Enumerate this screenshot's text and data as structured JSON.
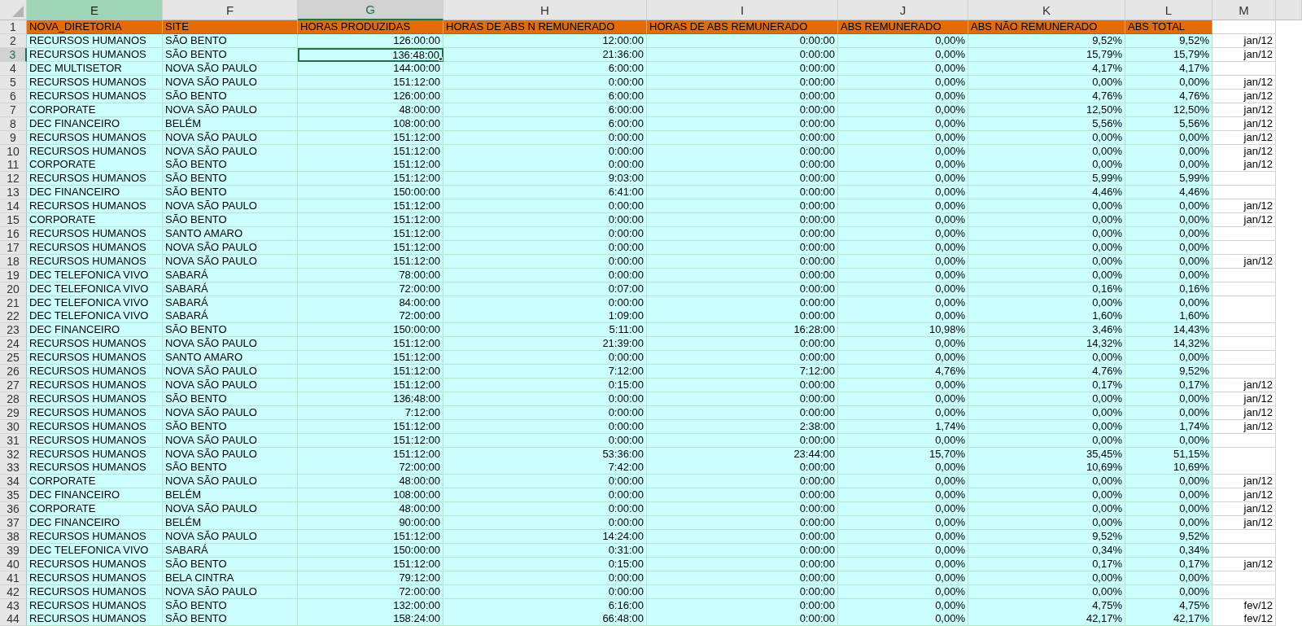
{
  "columns": [
    {
      "letter": "E",
      "kind": "text",
      "selected": false,
      "highlighted": true
    },
    {
      "letter": "F",
      "kind": "text",
      "selected": false,
      "highlighted": false
    },
    {
      "letter": "G",
      "kind": "number",
      "selected": true,
      "highlighted": false
    },
    {
      "letter": "H",
      "kind": "number",
      "selected": false,
      "highlighted": false
    },
    {
      "letter": "I",
      "kind": "number",
      "selected": false,
      "highlighted": false
    },
    {
      "letter": "J",
      "kind": "number",
      "selected": false,
      "highlighted": false
    },
    {
      "letter": "K",
      "kind": "number",
      "selected": false,
      "highlighted": false
    },
    {
      "letter": "L",
      "kind": "number",
      "selected": false,
      "highlighted": false
    },
    {
      "letter": "M",
      "kind": "number",
      "selected": false,
      "highlighted": false
    }
  ],
  "header_row": {
    "n": "1",
    "labels": [
      "NOVA_DIRETORIA",
      "SITE",
      "HORAS PRODUZIDAS",
      "HORAS DE ABS N REMUNERADO",
      "HORAS DE ABS REMUNERADO",
      "ABS REMUNERADO",
      "ABS NÃO REMUNERADO",
      "ABS TOTAL"
    ]
  },
  "rows": [
    {
      "n": "2",
      "selected": false,
      "cells": [
        "RECURSOS HUMANOS",
        "SÃO BENTO",
        "126:00:00",
        "12:00:00",
        "0:00:00",
        "0,00%",
        "9,52%",
        "9,52%",
        "jan/12"
      ]
    },
    {
      "n": "3",
      "selected": true,
      "cells": [
        "RECURSOS HUMANOS",
        "SÃO BENTO",
        "136:48:00",
        "21:36:00",
        "0:00:00",
        "0,00%",
        "15,79%",
        "15,79%",
        "jan/12"
      ]
    },
    {
      "n": "4",
      "selected": false,
      "cells": [
        "DEC MULTISETOR",
        "NOVA SÃO PAULO",
        "144:00:00",
        "6:00:00",
        "0:00:00",
        "0,00%",
        "4,17%",
        "4,17%"
      ]
    },
    {
      "n": "5",
      "selected": false,
      "cells": [
        "RECURSOS HUMANOS",
        "NOVA SÃO PAULO",
        "151:12:00",
        "0:00:00",
        "0:00:00",
        "0,00%",
        "0,00%",
        "0,00%",
        "jan/12"
      ]
    },
    {
      "n": "6",
      "selected": false,
      "cells": [
        "RECURSOS HUMANOS",
        "SÃO BENTO",
        "126:00:00",
        "6:00:00",
        "0:00:00",
        "0,00%",
        "4,76%",
        "4,76%",
        "jan/12"
      ]
    },
    {
      "n": "7",
      "selected": false,
      "cells": [
        "CORPORATE",
        "NOVA SÃO PAULO",
        "48:00:00",
        "6:00:00",
        "0:00:00",
        "0,00%",
        "12,50%",
        "12,50%",
        "jan/12"
      ]
    },
    {
      "n": "8",
      "selected": false,
      "cells": [
        "DEC FINANCEIRO",
        "BELÉM",
        "108:00:00",
        "6:00:00",
        "0:00:00",
        "0,00%",
        "5,56%",
        "5,56%",
        "jan/12"
      ]
    },
    {
      "n": "9",
      "selected": false,
      "cells": [
        "RECURSOS HUMANOS",
        "NOVA SÃO PAULO",
        "151:12:00",
        "0:00:00",
        "0:00:00",
        "0,00%",
        "0,00%",
        "0,00%",
        "jan/12"
      ]
    },
    {
      "n": "10",
      "selected": false,
      "cells": [
        "RECURSOS HUMANOS",
        "NOVA SÃO PAULO",
        "151:12:00",
        "0:00:00",
        "0:00:00",
        "0,00%",
        "0,00%",
        "0,00%",
        "jan/12"
      ]
    },
    {
      "n": "11",
      "selected": false,
      "cells": [
        "CORPORATE",
        "SÃO BENTO",
        "151:12:00",
        "0:00:00",
        "0:00:00",
        "0,00%",
        "0,00%",
        "0,00%",
        "jan/12"
      ]
    },
    {
      "n": "12",
      "selected": false,
      "cells": [
        "RECURSOS HUMANOS",
        "SÃO BENTO",
        "151:12:00",
        "9:03:00",
        "0:00:00",
        "0,00%",
        "5,99%",
        "5,99%"
      ]
    },
    {
      "n": "13",
      "selected": false,
      "cells": [
        "DEC FINANCEIRO",
        "SÃO BENTO",
        "150:00:00",
        "6:41:00",
        "0:00:00",
        "0,00%",
        "4,46%",
        "4,46%"
      ]
    },
    {
      "n": "14",
      "selected": false,
      "cells": [
        "RECURSOS HUMANOS",
        "NOVA SÃO PAULO",
        "151:12:00",
        "0:00:00",
        "0:00:00",
        "0,00%",
        "0,00%",
        "0,00%",
        "jan/12"
      ]
    },
    {
      "n": "15",
      "selected": false,
      "cells": [
        "CORPORATE",
        "SÃO BENTO",
        "151:12:00",
        "0:00:00",
        "0:00:00",
        "0,00%",
        "0,00%",
        "0,00%",
        "jan/12"
      ]
    },
    {
      "n": "16",
      "selected": false,
      "cells": [
        "RECURSOS HUMANOS",
        "SANTO AMARO",
        "151:12:00",
        "0:00:00",
        "0:00:00",
        "0,00%",
        "0,00%",
        "0,00%"
      ]
    },
    {
      "n": "17",
      "selected": false,
      "cells": [
        "RECURSOS HUMANOS",
        "NOVA SÃO PAULO",
        "151:12:00",
        "0:00:00",
        "0:00:00",
        "0,00%",
        "0,00%",
        "0,00%"
      ]
    },
    {
      "n": "18",
      "selected": false,
      "cells": [
        "RECURSOS HUMANOS",
        "NOVA SÃO PAULO",
        "151:12:00",
        "0:00:00",
        "0:00:00",
        "0,00%",
        "0,00%",
        "0,00%",
        "jan/12"
      ]
    },
    {
      "n": "19",
      "selected": false,
      "cells": [
        "DEC TELEFONICA VIVO",
        "SABARÁ",
        "78:00:00",
        "0:00:00",
        "0:00:00",
        "0,00%",
        "0,00%",
        "0,00%"
      ]
    },
    {
      "n": "20",
      "selected": false,
      "cells": [
        "DEC TELEFONICA VIVO",
        "SABARÁ",
        "72:00:00",
        "0:07:00",
        "0:00:00",
        "0,00%",
        "0,16%",
        "0,16%"
      ]
    },
    {
      "n": "21",
      "selected": false,
      "cells": [
        "DEC TELEFONICA VIVO",
        "SABARÁ",
        "84:00:00",
        "0:00:00",
        "0:00:00",
        "0,00%",
        "0,00%",
        "0,00%"
      ]
    },
    {
      "n": "22",
      "selected": false,
      "cells": [
        "DEC TELEFONICA VIVO",
        "SABARÁ",
        "72:00:00",
        "1:09:00",
        "0:00:00",
        "0,00%",
        "1,60%",
        "1,60%"
      ]
    },
    {
      "n": "23",
      "selected": false,
      "cells": [
        "DEC FINANCEIRO",
        "SÃO BENTO",
        "150:00:00",
        "5:11:00",
        "16:28:00",
        "10,98%",
        "3,46%",
        "14,43%"
      ]
    },
    {
      "n": "24",
      "selected": false,
      "cells": [
        "RECURSOS HUMANOS",
        "NOVA SÃO PAULO",
        "151:12:00",
        "21:39:00",
        "0:00:00",
        "0,00%",
        "14,32%",
        "14,32%"
      ]
    },
    {
      "n": "25",
      "selected": false,
      "cells": [
        "RECURSOS HUMANOS",
        "SANTO AMARO",
        "151:12:00",
        "0:00:00",
        "0:00:00",
        "0,00%",
        "0,00%",
        "0,00%"
      ]
    },
    {
      "n": "26",
      "selected": false,
      "cells": [
        "RECURSOS HUMANOS",
        "NOVA SÃO PAULO",
        "151:12:00",
        "7:12:00",
        "7:12:00",
        "4,76%",
        "4,76%",
        "9,52%"
      ]
    },
    {
      "n": "27",
      "selected": false,
      "cells": [
        "RECURSOS HUMANOS",
        "NOVA SÃO PAULO",
        "151:12:00",
        "0:15:00",
        "0:00:00",
        "0,00%",
        "0,17%",
        "0,17%",
        "jan/12"
      ]
    },
    {
      "n": "28",
      "selected": false,
      "cells": [
        "RECURSOS HUMANOS",
        "SÃO BENTO",
        "136:48:00",
        "0:00:00",
        "0:00:00",
        "0,00%",
        "0,00%",
        "0,00%",
        "jan/12"
      ]
    },
    {
      "n": "29",
      "selected": false,
      "cells": [
        "RECURSOS HUMANOS",
        "NOVA SÃO PAULO",
        "7:12:00",
        "0:00:00",
        "0:00:00",
        "0,00%",
        "0,00%",
        "0,00%",
        "jan/12"
      ]
    },
    {
      "n": "30",
      "selected": false,
      "cells": [
        "RECURSOS HUMANOS",
        "SÃO BENTO",
        "151:12:00",
        "0:00:00",
        "2:38:00",
        "1,74%",
        "0,00%",
        "1,74%",
        "jan/12"
      ]
    },
    {
      "n": "31",
      "selected": false,
      "cells": [
        "RECURSOS HUMANOS",
        "NOVA SÃO PAULO",
        "151:12:00",
        "0:00:00",
        "0:00:00",
        "0,00%",
        "0,00%",
        "0,00%"
      ]
    },
    {
      "n": "32",
      "selected": false,
      "cells": [
        "RECURSOS HUMANOS",
        "NOVA SÃO PAULO",
        "151:12:00",
        "53:36:00",
        "23:44:00",
        "15,70%",
        "35,45%",
        "51,15%"
      ]
    },
    {
      "n": "33",
      "selected": false,
      "cells": [
        "RECURSOS HUMANOS",
        "SÃO BENTO",
        "72:00:00",
        "7:42:00",
        "0:00:00",
        "0,00%",
        "10,69%",
        "10,69%"
      ]
    },
    {
      "n": "34",
      "selected": false,
      "cells": [
        "CORPORATE",
        "NOVA SÃO PAULO",
        "48:00:00",
        "0:00:00",
        "0:00:00",
        "0,00%",
        "0,00%",
        "0,00%",
        "jan/12"
      ]
    },
    {
      "n": "35",
      "selected": false,
      "cells": [
        "DEC FINANCEIRO",
        "BELÉM",
        "108:00:00",
        "0:00:00",
        "0:00:00",
        "0,00%",
        "0,00%",
        "0,00%",
        "jan/12"
      ]
    },
    {
      "n": "36",
      "selected": false,
      "cells": [
        "CORPORATE",
        "NOVA SÃO PAULO",
        "48:00:00",
        "0:00:00",
        "0:00:00",
        "0,00%",
        "0,00%",
        "0,00%",
        "jan/12"
      ]
    },
    {
      "n": "37",
      "selected": false,
      "cells": [
        "DEC FINANCEIRO",
        "BELÉM",
        "90:00:00",
        "0:00:00",
        "0:00:00",
        "0,00%",
        "0,00%",
        "0,00%",
        "jan/12"
      ]
    },
    {
      "n": "38",
      "selected": false,
      "cells": [
        "RECURSOS HUMANOS",
        "NOVA SÃO PAULO",
        "151:12:00",
        "14:24:00",
        "0:00:00",
        "0,00%",
        "9,52%",
        "9,52%"
      ]
    },
    {
      "n": "39",
      "selected": false,
      "cells": [
        "DEC TELEFONICA VIVO",
        "SABARÁ",
        "150:00:00",
        "0:31:00",
        "0:00:00",
        "0,00%",
        "0,34%",
        "0,34%"
      ]
    },
    {
      "n": "40",
      "selected": false,
      "cells": [
        "RECURSOS HUMANOS",
        "SÃO BENTO",
        "151:12:00",
        "0:15:00",
        "0:00:00",
        "0,00%",
        "0,17%",
        "0,17%",
        "jan/12"
      ]
    },
    {
      "n": "41",
      "selected": false,
      "cells": [
        "RECURSOS HUMANOS",
        "BELA CINTRA",
        "79:12:00",
        "0:00:00",
        "0:00:00",
        "0,00%",
        "0,00%",
        "0,00%"
      ]
    },
    {
      "n": "42",
      "selected": false,
      "cells": [
        "RECURSOS HUMANOS",
        "NOVA SÃO PAULO",
        "72:00:00",
        "0:00:00",
        "0:00:00",
        "0,00%",
        "0,00%",
        "0,00%"
      ]
    },
    {
      "n": "43",
      "selected": false,
      "cells": [
        "RECURSOS HUMANOS",
        "SÃO BENTO",
        "132:00:00",
        "6:16:00",
        "0:00:00",
        "0,00%",
        "4,75%",
        "4,75%",
        "fev/12"
      ]
    },
    {
      "n": "44",
      "selected": false,
      "cells": [
        "RECURSOS HUMANOS",
        "SÃO BENTO",
        "158:24:00",
        "66:48:00",
        "0:00:00",
        "0,00%",
        "42,17%",
        "42,17%",
        "fev/12"
      ]
    }
  ]
}
